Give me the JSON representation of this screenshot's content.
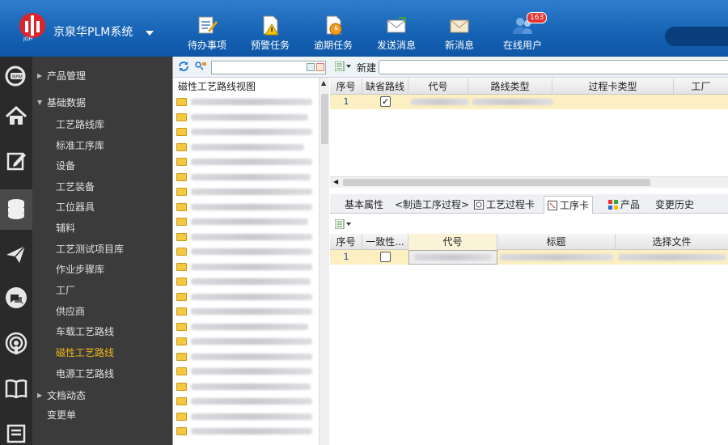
{
  "header": {
    "app_title": "京泉华PLM系统",
    "logo_text": "JQH",
    "toolbar": [
      {
        "label": "待办事项",
        "icon": "todo-icon"
      },
      {
        "label": "预警任务",
        "icon": "warning-task-icon"
      },
      {
        "label": "逾期任务",
        "icon": "overdue-task-icon"
      },
      {
        "label": "发送消息",
        "icon": "send-message-icon"
      },
      {
        "label": "新消息",
        "icon": "new-message-icon"
      },
      {
        "label": "在线用户",
        "icon": "online-users-icon"
      }
    ],
    "online_badge": "163"
  },
  "rail_icons": [
    "rpm-icon",
    "home-icon",
    "edit-icon",
    "database-icon",
    "send-icon",
    "chat-icon",
    "signal-icon",
    "book-icon",
    "report-icon"
  ],
  "nav": {
    "groups": [
      {
        "label": "产品管理",
        "expanded": false
      },
      {
        "label": "基础数据",
        "expanded": true
      },
      {
        "label": "文档动态",
        "expanded": false
      }
    ],
    "items": [
      "工艺路线库",
      "标准工序库",
      "设备",
      "工艺装备",
      "工位器具",
      "辅料",
      "工艺测试项目库",
      "作业步骤库",
      "工厂",
      "供应商",
      "车载工艺路线",
      "磁性工艺路线",
      "电源工艺路线"
    ],
    "active_item": "磁性工艺路线",
    "tail_item": "变更单"
  },
  "tree": {
    "header": "磁性工艺路线视图"
  },
  "main": {
    "new_label": "新建",
    "upper_columns": [
      "序号",
      "缺省路线",
      "代号",
      "路线类型",
      "过程卡类型",
      "工厂"
    ],
    "upper_row": {
      "index": "1",
      "default_checked": true
    },
    "tabs": [
      "基本属性",
      "<制造工序过程>",
      "工艺过程卡",
      "工序卡",
      "产品",
      "变更历史"
    ],
    "active_tab": "工序卡",
    "lower_columns": [
      "序号",
      "一致性...",
      "代号",
      "标题",
      "选择文件"
    ],
    "lower_row": {
      "index": "1",
      "consistency_checked": false
    }
  },
  "colors": {
    "header_blue": "#1662b4",
    "nav_bg": "#3b3b3b",
    "rail_bg": "#2a2a2a",
    "active_nav": "#f0b61a",
    "selected_row": "#fcf0c2"
  }
}
